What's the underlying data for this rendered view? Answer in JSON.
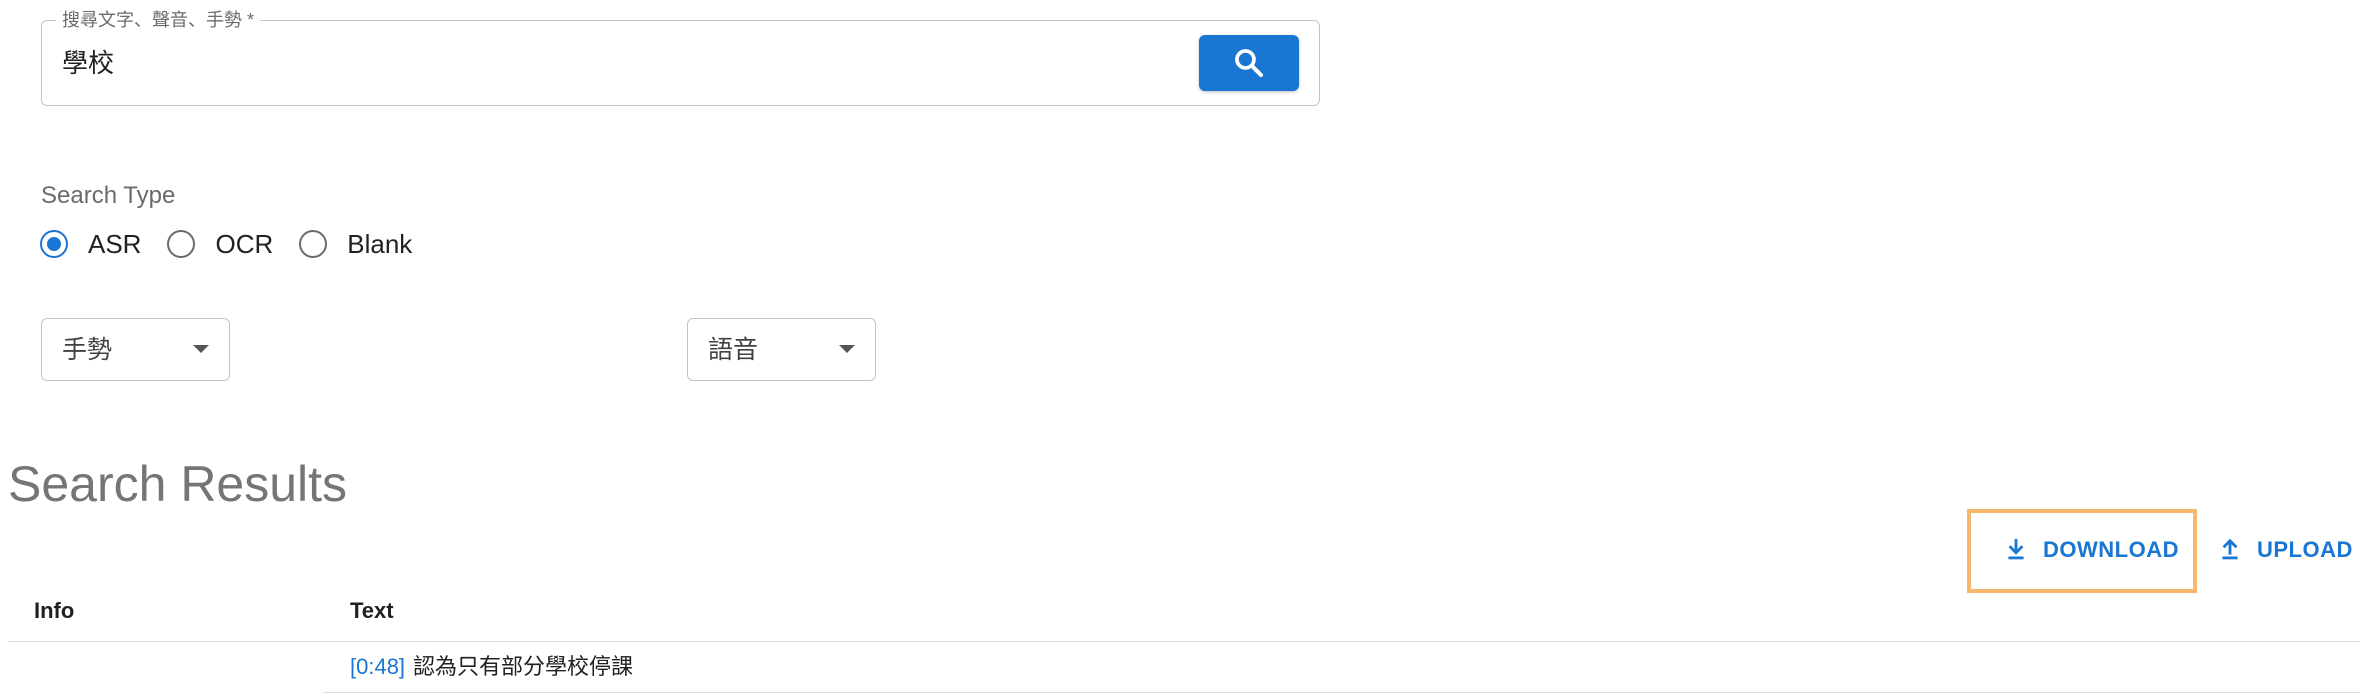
{
  "search": {
    "label": "搜尋文字、聲音、手勢 *",
    "value": "學校"
  },
  "search_type": {
    "label": "Search Type",
    "options": [
      {
        "label": "ASR",
        "checked": true
      },
      {
        "label": "OCR",
        "checked": false
      },
      {
        "label": "Blank",
        "checked": false
      }
    ]
  },
  "filters": {
    "gesture": "手勢",
    "speech": "語音"
  },
  "results": {
    "title": "Search Results",
    "download_label": "DOWNLOAD",
    "upload_label": "UPLOAD",
    "columns": [
      "Info",
      "Text"
    ],
    "rows": [
      {
        "info": "",
        "timestamp": "[0:48]",
        "text": "認為只有部分學校停課"
      }
    ]
  },
  "colors": {
    "accent": "#1976d2",
    "highlight": "#f6b96b"
  }
}
